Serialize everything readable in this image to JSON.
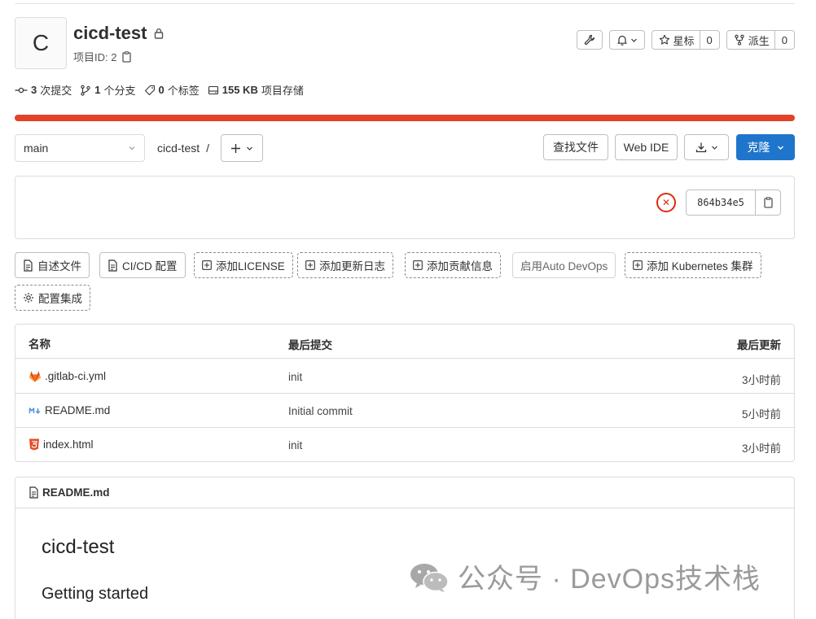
{
  "project": {
    "avatar_letter": "C",
    "name": "cicd-test",
    "id_label": "项目ID: 2"
  },
  "header_actions": {
    "star_label": "星标",
    "star_count": "0",
    "fork_label": "派生",
    "fork_count": "0"
  },
  "stats": {
    "commits_count": "3",
    "commits_label": "次提交",
    "branches_count": "1",
    "branches_label": "个分支",
    "tags_count": "0",
    "tags_label": "个标签",
    "storage_size": "155 KB",
    "storage_label": "项目存储"
  },
  "toolbar": {
    "branch": "main",
    "breadcrumb": "cicd-test",
    "breadcrumb_sep": "/",
    "find_file": "查找文件",
    "web_ide": "Web IDE",
    "clone": "克隆"
  },
  "commit": {
    "sha": "864b34e5",
    "pipeline_status": "failed"
  },
  "shortcuts": {
    "readme": "自述文件",
    "cicd": "CI/CD 配置",
    "license": "添加LICENSE",
    "changelog": "添加更新日志",
    "contributing": "添加贡献信息",
    "autodevops": "启用Auto DevOps",
    "kubernetes": "添加 Kubernetes 集群",
    "integrations": "配置集成"
  },
  "files": {
    "headers": {
      "name": "名称",
      "last_commit": "最后提交",
      "last_update": "最后更新"
    },
    "rows": [
      {
        "name": ".gitlab-ci.yml",
        "commit": "init",
        "updated": "3小时前",
        "icon": "gitlab-icon"
      },
      {
        "name": "README.md",
        "commit": "Initial commit",
        "updated": "5小时前",
        "icon": "markdown-icon"
      },
      {
        "name": "index.html",
        "commit": "init",
        "updated": "3小时前",
        "icon": "html5-icon"
      }
    ]
  },
  "readme": {
    "file": "README.md",
    "h1": "cicd-test",
    "h2": "Getting started"
  },
  "watermark": {
    "text": "公众号 · DevOps技术栈"
  },
  "colors": {
    "accent": "#1f75cb",
    "progress": "#e24329",
    "failed": "#dd2b0e"
  }
}
